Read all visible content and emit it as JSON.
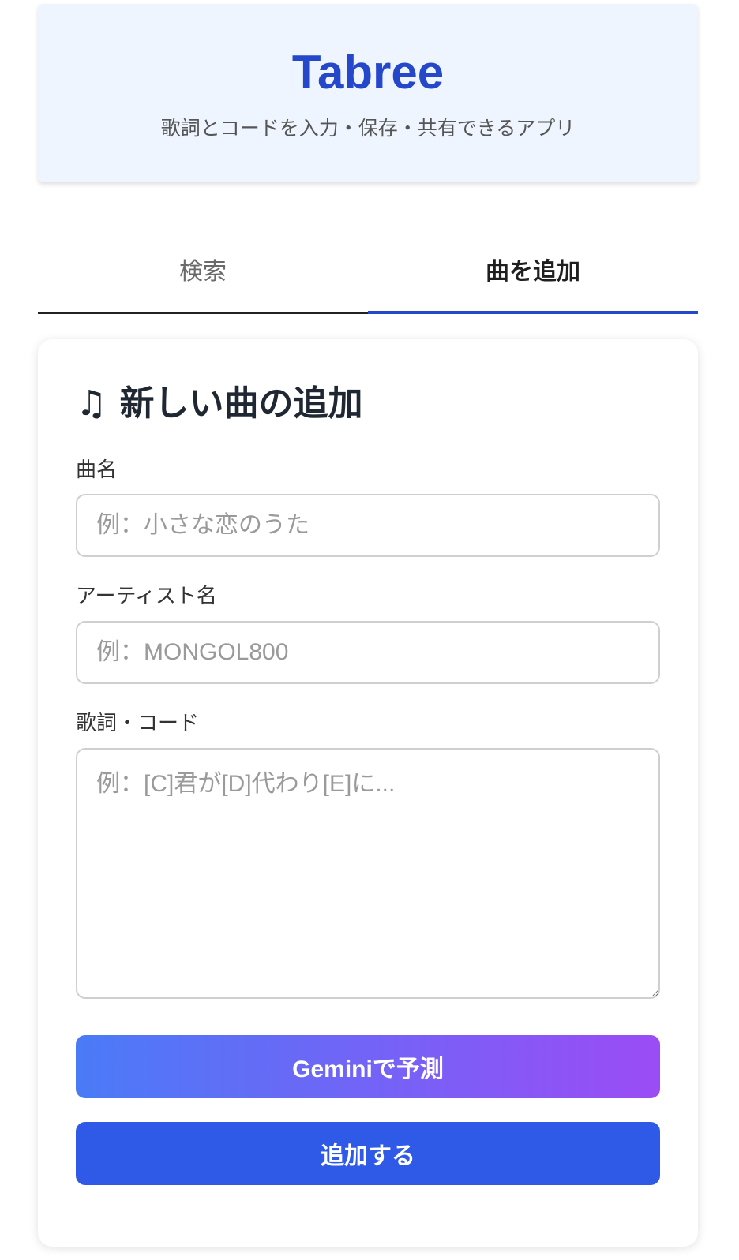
{
  "header": {
    "title": "Tabree",
    "subtitle": "歌詞とコードを入力・保存・共有できるアプリ"
  },
  "tabs": [
    {
      "label": "検索",
      "active": false
    },
    {
      "label": "曲を追加",
      "active": true
    }
  ],
  "form": {
    "heading_icon": "♫",
    "heading": "新しい曲の追加",
    "song_name": {
      "label": "曲名",
      "value": "",
      "placeholder": "例：小さな恋のうた"
    },
    "artist_name": {
      "label": "アーティスト名",
      "value": "",
      "placeholder": "例：MONGOL800"
    },
    "lyrics": {
      "label": "歌詞・コード",
      "value": "",
      "placeholder": "例：[C]君が[D]代わり[E]に..."
    },
    "gemini_button": "Geminiで予測",
    "submit_button": "追加する"
  },
  "colors": {
    "brand": "#2547c9",
    "header_bg": "#eff5fe",
    "submit_bg": "#2f5ae8",
    "gemini_gradient_start": "#4a7bf7",
    "gemini_gradient_end": "#9b4cf5"
  }
}
